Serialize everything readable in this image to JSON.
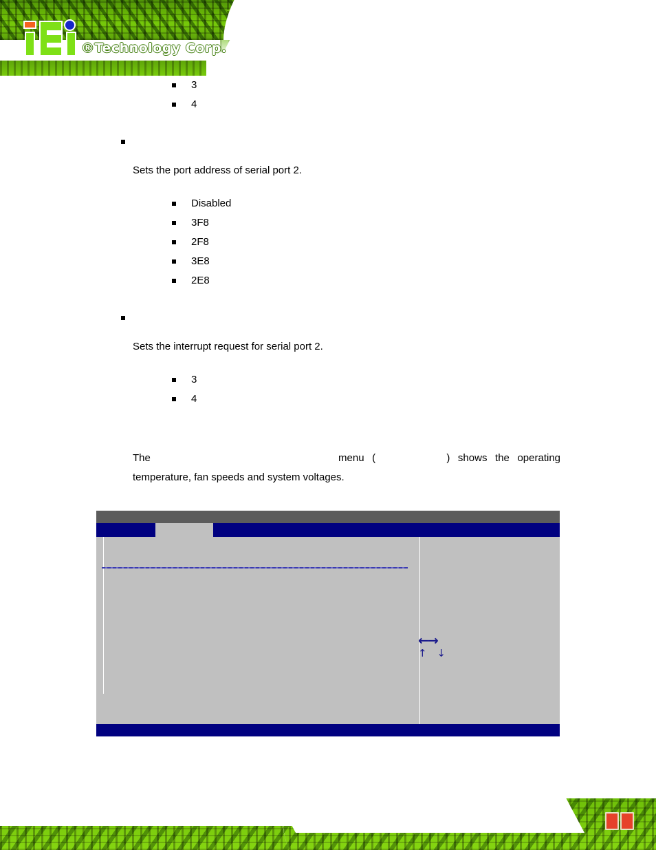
{
  "header": {
    "logo_text": "®Technology Corp.",
    "logo_name": "iEi"
  },
  "document": {
    "serial_port1_irq_options": [
      "3",
      "4"
    ],
    "section_serial_port2_address": {
      "heading": "",
      "description": "Sets the port address of serial port 2.",
      "options": [
        "Disabled",
        "3F8",
        "2F8",
        "3E8",
        "2E8"
      ]
    },
    "section_serial_port2_irq": {
      "heading": "",
      "description": "Sets the interrupt request for serial port 2.",
      "options": [
        "3",
        "4"
      ]
    },
    "section_hw_monitor": {
      "heading": "",
      "paragraph_prefix": "The",
      "paragraph_menu_name": "",
      "paragraph_mid": "menu (",
      "paragraph_figure_ref": "",
      "paragraph_suffix": ") shows the operating temperature, fan speeds and system voltages."
    }
  },
  "bios": {
    "title": "",
    "menu_tabs": [
      {
        "label": "",
        "active": false
      },
      {
        "label": "",
        "active": true
      },
      {
        "label": "",
        "active": false
      }
    ],
    "fields": [],
    "help_text": "",
    "nav_arrows_lr": "←→",
    "nav_arrows_ud": "↑ ↓",
    "footer_text": ""
  },
  "colors": {
    "bios_menubar": "#000080",
    "bios_titlebar": "#5c5c5c",
    "bios_panel": "#c0c0c0",
    "bios_accent_blue": "#000080",
    "brand_green": "#6cbb08",
    "brand_orange": "#f4621f",
    "brand_blue_dot": "#1526c8"
  }
}
